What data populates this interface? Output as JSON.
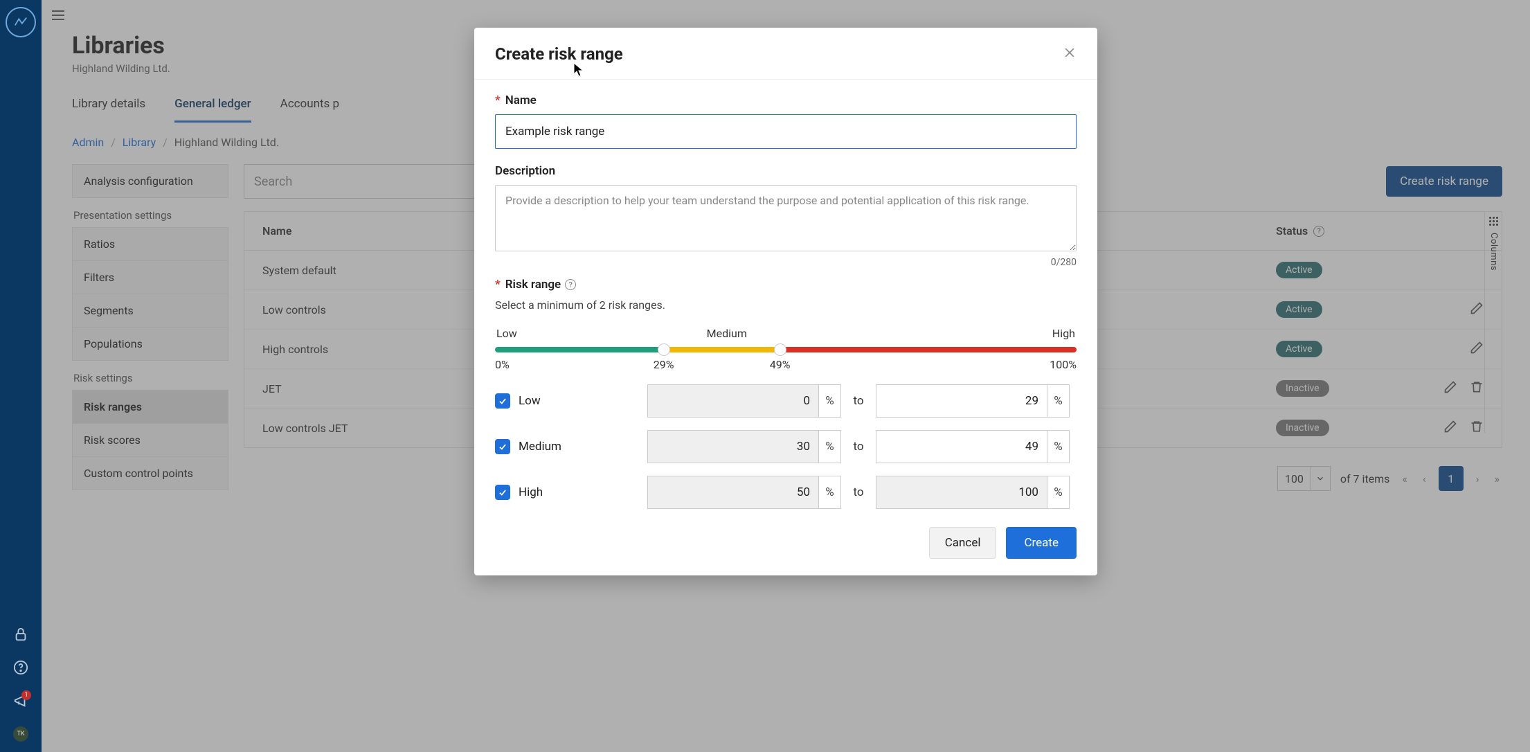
{
  "rail": {
    "notif_count": "1",
    "avatar_initials": "TK"
  },
  "page": {
    "title": "Libraries",
    "subtitle": "Highland Wilding Ltd."
  },
  "tabs": {
    "details": "Library details",
    "gl": "General ledger",
    "ap": "Accounts p"
  },
  "breadcrumbs": {
    "admin": "Admin",
    "library": "Library",
    "current": "Highland Wilding Ltd."
  },
  "sidebar": {
    "analysis_config": "Analysis configuration",
    "presentation_heading": "Presentation settings",
    "ratios": "Ratios",
    "filters": "Filters",
    "segments": "Segments",
    "populations": "Populations",
    "risk_heading": "Risk settings",
    "risk_ranges": "Risk ranges",
    "risk_scores": "Risk scores",
    "ccp": "Custom control points"
  },
  "toolbar": {
    "search_placeholder": "Search",
    "create_btn": "Create risk range"
  },
  "table": {
    "col_name": "Name",
    "col_status": "Status",
    "status_active": "Active",
    "status_inactive": "Inactive",
    "rows": {
      "r0": "System default",
      "r1": "Low controls",
      "r2": "High controls",
      "r3": "JET",
      "r4": "Low controls JET"
    }
  },
  "columns_rail": "Columns",
  "pagination": {
    "page_size": "100",
    "of_items": "of 7 items",
    "cur": "1"
  },
  "modal": {
    "title": "Create risk range",
    "name_label": "Name",
    "name_value": "Example risk range",
    "desc_label": "Description",
    "desc_placeholder": "Provide a description to help your team understand the purpose and potential application of this risk range.",
    "char_count": "0/280",
    "range_label": "Risk range",
    "range_hint": "Select a minimum of 2 risk ranges.",
    "low": "Low",
    "med": "Medium",
    "high": "High",
    "tick0": "0%",
    "tick1": "29%",
    "tick2": "49%",
    "tick3": "100%",
    "to": "to",
    "low_from": "0",
    "low_to": "29",
    "med_from": "30",
    "med_to": "49",
    "high_from": "50",
    "high_to": "100",
    "pct": "%",
    "cancel": "Cancel",
    "create": "Create"
  }
}
